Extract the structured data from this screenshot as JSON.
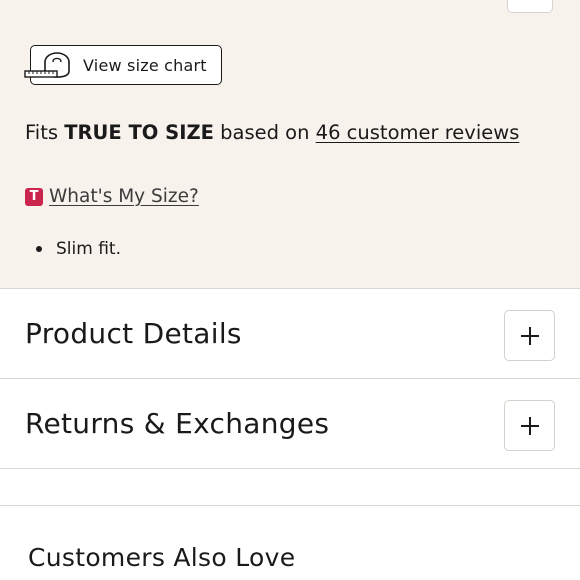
{
  "size_chart": {
    "label": "View size chart",
    "icon": "tape-measure-icon"
  },
  "fit": {
    "prefix": "Fits ",
    "emphasis": "TRUE TO SIZE",
    "middle": " based on ",
    "reviews_link": "46 customer reviews"
  },
  "whats_my_size": {
    "badge": "T",
    "badge_color": "#c9254d",
    "link": "What's My Size?"
  },
  "fit_notes": [
    "Slim fit."
  ],
  "accordions": [
    {
      "title": "Product Details",
      "icon": "plus-icon"
    },
    {
      "title": "Returns & Exchanges",
      "icon": "plus-icon"
    }
  ],
  "also_love": {
    "heading": "Customers Also Love"
  },
  "colors": {
    "panel_background": "#f8f2ed",
    "divider": "#dcd6d1"
  }
}
